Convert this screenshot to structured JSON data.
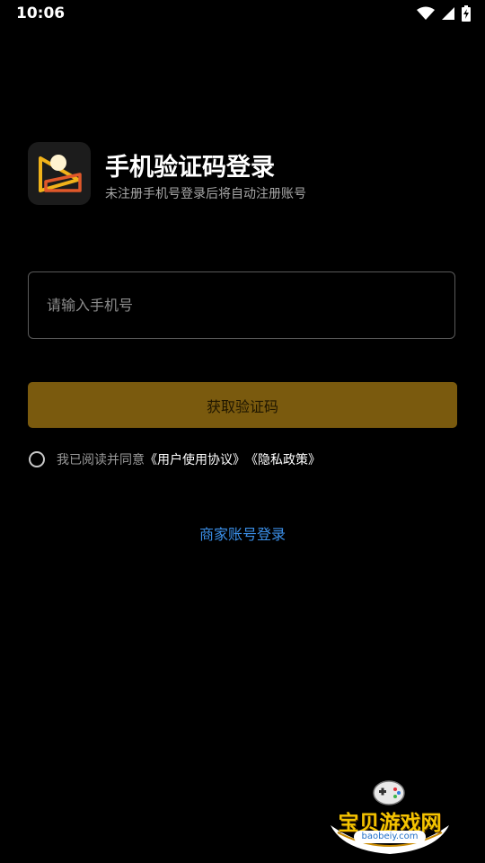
{
  "status_bar": {
    "time": "10:06",
    "icons": [
      "wifi-icon",
      "signal-icon",
      "battery-charging-icon"
    ]
  },
  "header": {
    "logo_icon": "app-logo-icon",
    "title": "手机验证码登录",
    "subtitle": "未注册手机号登录后将自动注册账号"
  },
  "form": {
    "phone_input": {
      "placeholder": "请输入手机号",
      "value": ""
    },
    "get_code_button": {
      "label": "获取验证码",
      "background": "#7a5a0e",
      "enabled": false
    },
    "agreement": {
      "checked": false,
      "prefix": "我已阅读并同意",
      "user_agreement": "《用户使用协议》",
      "privacy_policy": "《隐私政策》"
    }
  },
  "merchant_login": {
    "label": "商家账号登录",
    "color": "#3b8fe8"
  },
  "watermark": {
    "text": "宝贝游戏网",
    "url": "baobeiy.com"
  },
  "colors": {
    "background": "#000000",
    "accent_gold": "#7a5a0e",
    "link_blue": "#3b8fe8"
  }
}
